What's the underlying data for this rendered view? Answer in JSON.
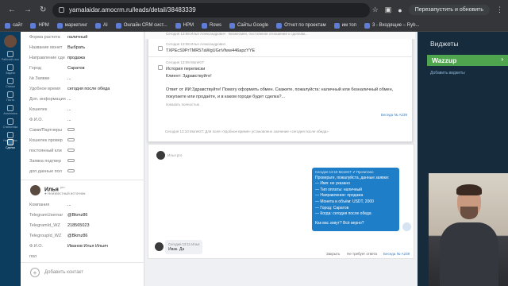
{
  "browser": {
    "url": "yamalaidar.amocrm.ru/leads/detail/38483339",
    "relaunch_label": "Перезапустить и обновить",
    "bookmarks": [
      "сайт",
      "HPM",
      "маркетинг",
      "AI",
      "Онлайн CRM сист...",
      "HPM",
      "Rows",
      "Сайты Google",
      "Отчет по проектам",
      "им топ",
      "3 - Входящие – Ryb..."
    ]
  },
  "left_nav": [
    "Рабочий стол",
    "Сделки",
    "Задачи",
    "Списки",
    "Почта",
    "Аналитика",
    "Статистика",
    "Настройки"
  ],
  "lead_fields": [
    {
      "key": "Форма расчета",
      "value": "наличный"
    },
    {
      "key": "Название монет",
      "value": "Выбрать"
    },
    {
      "key": "Направление сде",
      "value": "продажа"
    },
    {
      "key": "Город",
      "value": "Саратов"
    },
    {
      "key": "№ Заявки",
      "value": "..."
    },
    {
      "key": "Удобное время",
      "value": "сегодня после обеда"
    },
    {
      "key": "Доп. информация",
      "value": "..."
    },
    {
      "key": "Кошелек",
      "value": "..."
    },
    {
      "key": "Ф.И.О.",
      "value": "..."
    },
    {
      "key": "Сами/Партнеры",
      "value": ""
    },
    {
      "key": "Кошелек провер",
      "value": ""
    },
    {
      "key": "постоянный кли",
      "value": ""
    },
    {
      "key": "Заявка подтвер",
      "value": ""
    },
    {
      "key": "доп данные пол",
      "value": ""
    }
  ],
  "contact": {
    "name": "Илья",
    "name_sup": "pro",
    "status": "Неизвестный источник",
    "fields": [
      {
        "key": "Компания",
        "value": "..."
      },
      {
        "key": "TelegramUsernar",
        "value": "@Bkmz86"
      },
      {
        "key": "TelegramId_WZ",
        "value": "218565023"
      },
      {
        "key": "TelegroupId_WZ",
        "value": "@Bkmz86"
      },
      {
        "key": "Ф.И.О.",
        "value": "Иванов Илья Ильич"
      },
      {
        "key": "пол",
        "value": ""
      }
    ],
    "add_label": "Добавить контакт"
  },
  "popup": {
    "tooltip": "Сегодня 13:08 Илья Александрович · Бизнесмен, постоянное отношение к сделкам...",
    "item1_meta": "Сегодня 13:08 Илья Александрович",
    "item1_text": "TXPEcS9PrTMR57aWgUGnVfww446apzYYE",
    "item2_meta": "Сегодня 13:09 MoreKIT",
    "item2_title": "История переписки",
    "item2_l1": "Клиент: Здравствуйте!",
    "item2_l2": "Ответ от ИИ:Здравствуйте! Помогу оформить обмен. Скажите, пожалуйста: наличный или безналичный обмен,",
    "item2_l3": "покупаете или продаёте, и в каком городе будет сделка?...",
    "item2_more": "показать полностью",
    "item2_right": "Беседа № A239"
  },
  "feed": {
    "change_note": "Сегодня 13:10 MoreKIT: Для поля «Удобное время» установлено значение «сегодня после обеда»",
    "sender": "Илья",
    "sender_sup": "pro",
    "bubble_header": "Сегодня 13:10 MoreKIT ✔ Прочитано",
    "bubble_lines": [
      "Проверьте, пожалуйста, данные заявки:",
      "— Имя: не указано",
      "— Тип оплаты: наличный",
      "— Направление: продажа",
      "— Монета и объём: USDT, 2000",
      "— Город: Саратов",
      "— Когда: сегодня после обеда",
      "",
      "Как вас зовут? Всё верно?"
    ],
    "reply_header": "Сегодня 13:11 Илья",
    "reply_text": "Ивак. Да",
    "close_label": "Закрыть",
    "no_reply_label": "Не требует ответа",
    "chat_label": "Беседа № A239"
  },
  "widgets": {
    "title": "Виджеты",
    "wazzup": "Wazzup",
    "add_label": "Добавить виджеты"
  }
}
